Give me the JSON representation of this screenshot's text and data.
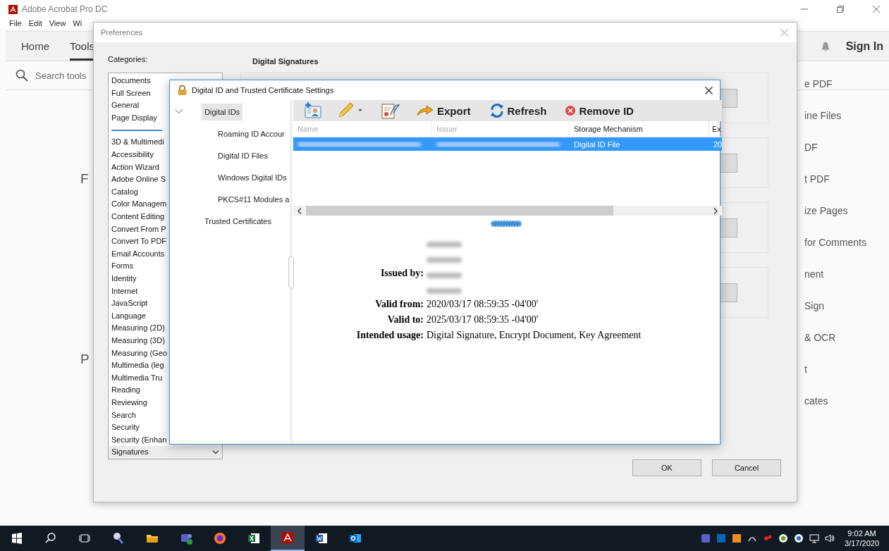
{
  "app": {
    "title": "Adobe Acrobat Pro DC",
    "menu": [
      "File",
      "Edit",
      "View",
      "Wi"
    ],
    "tabs": [
      {
        "label": "Home",
        "selected": false
      },
      {
        "label": "Tools",
        "selected": true
      }
    ],
    "search": {
      "placeholder": "Search tools"
    },
    "sign_in": "Sign In",
    "content_fragments": [
      "F",
      "P"
    ],
    "tool_list": [
      "e PDF",
      "ine Files",
      "DF",
      "t PDF",
      "ize Pages",
      "for Comments",
      "nent",
      "Sign",
      "& OCR",
      "t",
      "cates"
    ]
  },
  "preferences": {
    "title": "Preferences",
    "categories_label": "Categories:",
    "top_categories": [
      {
        "label": "Documents",
        "selected": false
      },
      {
        "label": "Full Screen",
        "selected": false
      },
      {
        "label": "General",
        "selected": false
      },
      {
        "label": "Page Display",
        "selected": false
      }
    ],
    "categories": [
      {
        "label": "3D & Multimedi",
        "selected": false
      },
      {
        "label": "Accessibility",
        "selected": false
      },
      {
        "label": "Action Wizard",
        "selected": false
      },
      {
        "label": "Adobe Online S",
        "selected": false
      },
      {
        "label": "Catalog",
        "selected": false
      },
      {
        "label": "Color Managem",
        "selected": false
      },
      {
        "label": "Content Editing",
        "selected": false
      },
      {
        "label": "Convert From P",
        "selected": false
      },
      {
        "label": "Convert To PDF",
        "selected": false
      },
      {
        "label": "Email Accounts",
        "selected": false
      },
      {
        "label": "Forms",
        "selected": false
      },
      {
        "label": "Identity",
        "selected": false
      },
      {
        "label": "Internet",
        "selected": false
      },
      {
        "label": "JavaScript",
        "selected": false
      },
      {
        "label": "Language",
        "selected": false
      },
      {
        "label": "Measuring (2D)",
        "selected": false
      },
      {
        "label": "Measuring (3D)",
        "selected": false
      },
      {
        "label": "Measuring (Geo",
        "selected": false
      },
      {
        "label": "Multimedia (leg",
        "selected": false
      },
      {
        "label": "Multimedia Tru",
        "selected": false
      },
      {
        "label": "Reading",
        "selected": false
      },
      {
        "label": "Reviewing",
        "selected": false
      },
      {
        "label": "Search",
        "selected": false
      },
      {
        "label": "Security",
        "selected": false
      },
      {
        "label": "Security (Enhan",
        "selected": false
      },
      {
        "label": "Signatures",
        "selected": true
      }
    ],
    "section_title": "Digital Signatures",
    "buttons": [
      "OK",
      "Cancel"
    ]
  },
  "digital_id_dialog": {
    "title": "Digital ID and Trusted Certificate Settings",
    "tree": [
      {
        "label": "Digital IDs",
        "selected": true,
        "expanded": true,
        "children": [
          {
            "label": "Roaming ID Accour",
            "selected": false
          },
          {
            "label": "Digital ID Files",
            "selected": false
          },
          {
            "label": "Windows Digital IDs",
            "selected": false
          },
          {
            "label": "PKCS#11 Modules a",
            "selected": false
          }
        ]
      },
      {
        "label": "Trusted Certificates",
        "selected": false
      }
    ],
    "toolbar": [
      {
        "kind": "add"
      },
      {
        "kind": "edit"
      },
      {
        "kind": "certificate"
      },
      {
        "kind": "export",
        "label": "Export"
      },
      {
        "kind": "refresh",
        "label": "Refresh"
      },
      {
        "kind": "remove",
        "label": "Remove ID"
      }
    ],
    "table": {
      "columns": [
        "Name",
        "Issuer",
        "Storage Mechanism",
        "Ex"
      ],
      "rows": [
        {
          "selected": true,
          "storage_mechanism": "Digital ID File",
          "column_4": "20"
        }
      ]
    },
    "details": [
      {
        "label": "Issued by:"
      },
      {
        "label": "Valid from:",
        "value": "2020/03/17 08:59:35 -04'00'"
      },
      {
        "label": "Valid to:",
        "value": "2025/03/17 08:59:35 -04'00'"
      },
      {
        "label": "Intended usage:",
        "value": "Digital Signature, Encrypt Document, Key Agreement"
      }
    ]
  },
  "taskbar": {
    "time": "9:02 AM",
    "date": "3/17/2020"
  }
}
